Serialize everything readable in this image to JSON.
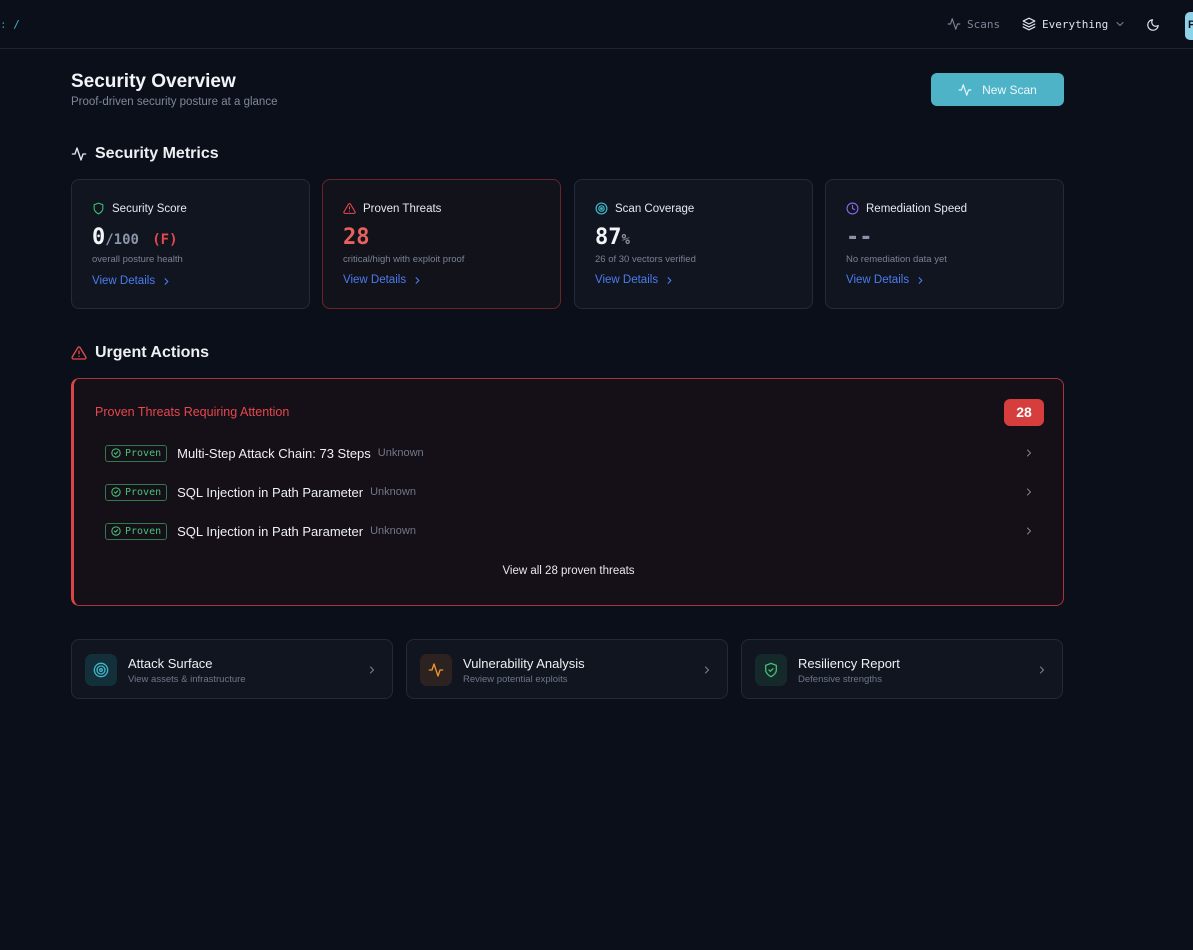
{
  "topbar": {
    "crumb_prefix": ":",
    "crumb_path": "/",
    "scans_label": "Scans",
    "scope_label": "Everything",
    "avatar_initial": "P"
  },
  "header": {
    "title": "Security Overview",
    "subtitle": "Proof-driven security posture at a glance",
    "new_scan_label": "New Scan"
  },
  "metrics_section": {
    "title": "Security Metrics"
  },
  "metrics": [
    {
      "title": "Security Score",
      "value": "0",
      "suffix": "/100",
      "grade": "(F)",
      "description": "overall posture health",
      "link": "View Details"
    },
    {
      "title": "Proven Threats",
      "value": "28",
      "description": "critical/high with exploit proof",
      "link": "View Details"
    },
    {
      "title": "Scan Coverage",
      "value": "87",
      "suffix": "%",
      "description": "26 of 30 vectors verified",
      "link": "View Details"
    },
    {
      "title": "Remediation Speed",
      "value": "--",
      "description": "No remediation data yet",
      "link": "View Details"
    }
  ],
  "urgent_section": {
    "title": "Urgent Actions"
  },
  "urgent": {
    "title": "Proven Threats Requiring Attention",
    "count": "28",
    "threats": [
      {
        "badge": "Proven",
        "name": "Multi-Step Attack Chain: 73 Steps",
        "severity": "Unknown"
      },
      {
        "badge": "Proven",
        "name": "SQL Injection in Path Parameter",
        "severity": "Unknown"
      },
      {
        "badge": "Proven",
        "name": "SQL Injection in Path Parameter",
        "severity": "Unknown"
      }
    ],
    "view_all": "View all 28 proven threats"
  },
  "nav_cards": [
    {
      "title": "Attack Surface",
      "subtitle": "View assets & infrastructure",
      "icon": "target-icon",
      "color": "#3fb6c9"
    },
    {
      "title": "Vulnerability Analysis",
      "subtitle": "Review potential exploits",
      "icon": "activity-icon",
      "color": "#f0952e"
    },
    {
      "title": "Resiliency Report",
      "subtitle": "Defensive strengths",
      "icon": "shield-check-icon",
      "color": "#3fbf74"
    }
  ],
  "colors": {
    "accent": "#4fb3c8",
    "danger": "#e5484d",
    "success": "#49c07a",
    "link": "#4c7cf0",
    "background": "#0b0f1a"
  }
}
